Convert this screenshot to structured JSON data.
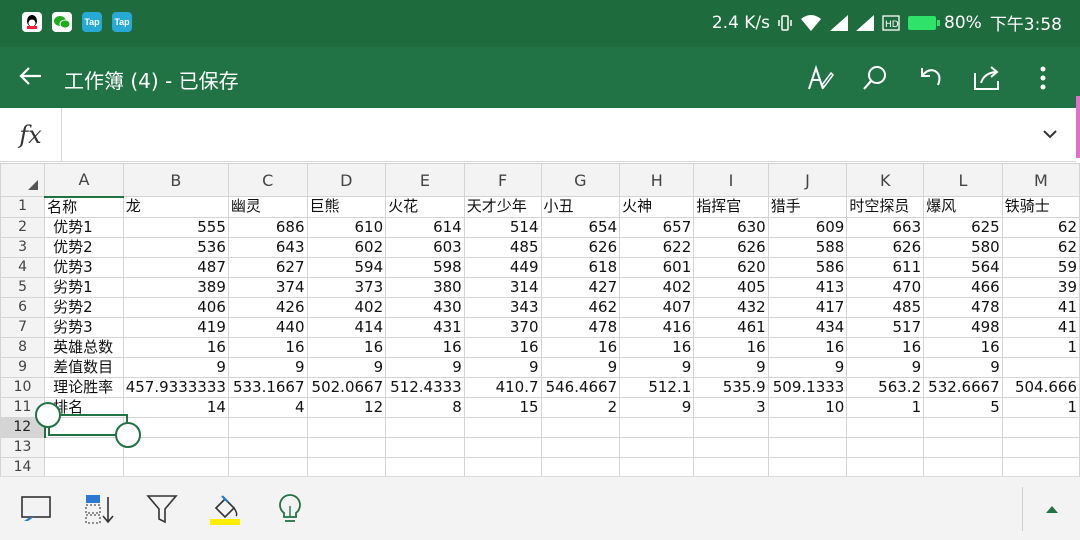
{
  "status_bar": {
    "left_icons": [
      "qq-icon",
      "wechat-icon",
      "taptap-icon",
      "taptap-icon"
    ],
    "tap_label": "Tap",
    "net_speed": "2.4 K/s",
    "battery": "80%",
    "time": "下午3:58"
  },
  "app_bar": {
    "title": "工作簿 (4) - 已保存"
  },
  "formula_bar": {
    "fx_label": "fx",
    "value": ""
  },
  "sheet": {
    "columns": [
      "A",
      "B",
      "C",
      "D",
      "E",
      "F",
      "G",
      "H",
      "I",
      "J",
      "K",
      "L",
      "M"
    ],
    "row_numbers": [
      "1",
      "2",
      "3",
      "4",
      "5",
      "6",
      "7",
      "8",
      "9",
      "10",
      "11",
      "12",
      "13",
      "14"
    ],
    "rows": [
      [
        "名称",
        "龙",
        "幽灵",
        "巨熊",
        "火花",
        "天才少年",
        "小丑",
        "火神",
        "指挥官",
        "猎手",
        "时空探员",
        "爆风",
        "铁骑士"
      ],
      [
        "优势1",
        "555",
        "686",
        "610",
        "614",
        "514",
        "654",
        "657",
        "630",
        "609",
        "663",
        "625",
        "62"
      ],
      [
        "优势2",
        "536",
        "643",
        "602",
        "603",
        "485",
        "626",
        "622",
        "626",
        "588",
        "626",
        "580",
        "62"
      ],
      [
        "优势3",
        "487",
        "627",
        "594",
        "598",
        "449",
        "618",
        "601",
        "620",
        "586",
        "611",
        "564",
        "59"
      ],
      [
        "劣势1",
        "389",
        "374",
        "373",
        "380",
        "314",
        "427",
        "402",
        "405",
        "413",
        "470",
        "466",
        "39"
      ],
      [
        "劣势2",
        "406",
        "426",
        "402",
        "430",
        "343",
        "462",
        "407",
        "432",
        "417",
        "485",
        "478",
        "41"
      ],
      [
        "劣势3",
        "419",
        "440",
        "414",
        "431",
        "370",
        "478",
        "416",
        "461",
        "434",
        "517",
        "498",
        "41"
      ],
      [
        "英雄总数",
        "16",
        "16",
        "16",
        "16",
        "16",
        "16",
        "16",
        "16",
        "16",
        "16",
        "16",
        "1"
      ],
      [
        "差值数目",
        "9",
        "9",
        "9",
        "9",
        "9",
        "9",
        "9",
        "9",
        "9",
        "9",
        "9",
        ""
      ],
      [
        "理论胜率",
        "457.9333333",
        "533.1667",
        "502.0667",
        "512.4333",
        "410.7",
        "546.4667",
        "512.1",
        "535.9",
        "509.1333",
        "563.2",
        "532.6667",
        "504.666"
      ],
      [
        "排名",
        "14",
        "4",
        "12",
        "8",
        "15",
        "2",
        "9",
        "3",
        "10",
        "1",
        "5",
        "1"
      ],
      [
        "",
        "",
        "",
        "",
        "",
        "",
        "",
        "",
        "",
        "",
        "",
        "",
        ""
      ],
      [
        "",
        "",
        "",
        "",
        "",
        "",
        "",
        "",
        "",
        "",
        "",
        "",
        ""
      ],
      [
        "",
        "",
        "",
        "",
        "",
        "",
        "",
        "",
        "",
        "",
        "",
        "",
        ""
      ]
    ],
    "selected_cell": "A12"
  },
  "bottom_toolbar": {
    "items": [
      "select-all-icon",
      "sort-icon",
      "filter-icon",
      "fill-color-icon",
      "idea-bulb-icon",
      "expand-up-icon"
    ],
    "fill_color": "#ffee00",
    "accent": "#217346"
  }
}
